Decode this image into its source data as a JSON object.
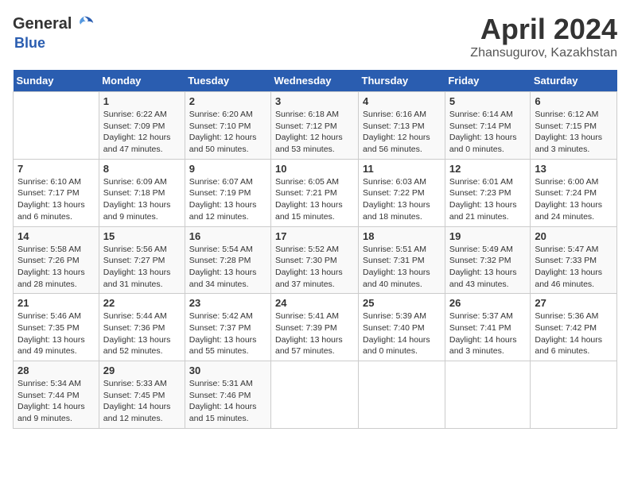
{
  "header": {
    "logo_general": "General",
    "logo_blue": "Blue",
    "title": "April 2024",
    "subtitle": "Zhansugurov, Kazakhstan"
  },
  "calendar": {
    "days_of_week": [
      "Sunday",
      "Monday",
      "Tuesday",
      "Wednesday",
      "Thursday",
      "Friday",
      "Saturday"
    ],
    "weeks": [
      [
        {
          "day": "",
          "info": ""
        },
        {
          "day": "1",
          "info": "Sunrise: 6:22 AM\nSunset: 7:09 PM\nDaylight: 12 hours\nand 47 minutes."
        },
        {
          "day": "2",
          "info": "Sunrise: 6:20 AM\nSunset: 7:10 PM\nDaylight: 12 hours\nand 50 minutes."
        },
        {
          "day": "3",
          "info": "Sunrise: 6:18 AM\nSunset: 7:12 PM\nDaylight: 12 hours\nand 53 minutes."
        },
        {
          "day": "4",
          "info": "Sunrise: 6:16 AM\nSunset: 7:13 PM\nDaylight: 12 hours\nand 56 minutes."
        },
        {
          "day": "5",
          "info": "Sunrise: 6:14 AM\nSunset: 7:14 PM\nDaylight: 13 hours\nand 0 minutes."
        },
        {
          "day": "6",
          "info": "Sunrise: 6:12 AM\nSunset: 7:15 PM\nDaylight: 13 hours\nand 3 minutes."
        }
      ],
      [
        {
          "day": "7",
          "info": "Sunrise: 6:10 AM\nSunset: 7:17 PM\nDaylight: 13 hours\nand 6 minutes."
        },
        {
          "day": "8",
          "info": "Sunrise: 6:09 AM\nSunset: 7:18 PM\nDaylight: 13 hours\nand 9 minutes."
        },
        {
          "day": "9",
          "info": "Sunrise: 6:07 AM\nSunset: 7:19 PM\nDaylight: 13 hours\nand 12 minutes."
        },
        {
          "day": "10",
          "info": "Sunrise: 6:05 AM\nSunset: 7:21 PM\nDaylight: 13 hours\nand 15 minutes."
        },
        {
          "day": "11",
          "info": "Sunrise: 6:03 AM\nSunset: 7:22 PM\nDaylight: 13 hours\nand 18 minutes."
        },
        {
          "day": "12",
          "info": "Sunrise: 6:01 AM\nSunset: 7:23 PM\nDaylight: 13 hours\nand 21 minutes."
        },
        {
          "day": "13",
          "info": "Sunrise: 6:00 AM\nSunset: 7:24 PM\nDaylight: 13 hours\nand 24 minutes."
        }
      ],
      [
        {
          "day": "14",
          "info": "Sunrise: 5:58 AM\nSunset: 7:26 PM\nDaylight: 13 hours\nand 28 minutes."
        },
        {
          "day": "15",
          "info": "Sunrise: 5:56 AM\nSunset: 7:27 PM\nDaylight: 13 hours\nand 31 minutes."
        },
        {
          "day": "16",
          "info": "Sunrise: 5:54 AM\nSunset: 7:28 PM\nDaylight: 13 hours\nand 34 minutes."
        },
        {
          "day": "17",
          "info": "Sunrise: 5:52 AM\nSunset: 7:30 PM\nDaylight: 13 hours\nand 37 minutes."
        },
        {
          "day": "18",
          "info": "Sunrise: 5:51 AM\nSunset: 7:31 PM\nDaylight: 13 hours\nand 40 minutes."
        },
        {
          "day": "19",
          "info": "Sunrise: 5:49 AM\nSunset: 7:32 PM\nDaylight: 13 hours\nand 43 minutes."
        },
        {
          "day": "20",
          "info": "Sunrise: 5:47 AM\nSunset: 7:33 PM\nDaylight: 13 hours\nand 46 minutes."
        }
      ],
      [
        {
          "day": "21",
          "info": "Sunrise: 5:46 AM\nSunset: 7:35 PM\nDaylight: 13 hours\nand 49 minutes."
        },
        {
          "day": "22",
          "info": "Sunrise: 5:44 AM\nSunset: 7:36 PM\nDaylight: 13 hours\nand 52 minutes."
        },
        {
          "day": "23",
          "info": "Sunrise: 5:42 AM\nSunset: 7:37 PM\nDaylight: 13 hours\nand 55 minutes."
        },
        {
          "day": "24",
          "info": "Sunrise: 5:41 AM\nSunset: 7:39 PM\nDaylight: 13 hours\nand 57 minutes."
        },
        {
          "day": "25",
          "info": "Sunrise: 5:39 AM\nSunset: 7:40 PM\nDaylight: 14 hours\nand 0 minutes."
        },
        {
          "day": "26",
          "info": "Sunrise: 5:37 AM\nSunset: 7:41 PM\nDaylight: 14 hours\nand 3 minutes."
        },
        {
          "day": "27",
          "info": "Sunrise: 5:36 AM\nSunset: 7:42 PM\nDaylight: 14 hours\nand 6 minutes."
        }
      ],
      [
        {
          "day": "28",
          "info": "Sunrise: 5:34 AM\nSunset: 7:44 PM\nDaylight: 14 hours\nand 9 minutes."
        },
        {
          "day": "29",
          "info": "Sunrise: 5:33 AM\nSunset: 7:45 PM\nDaylight: 14 hours\nand 12 minutes."
        },
        {
          "day": "30",
          "info": "Sunrise: 5:31 AM\nSunset: 7:46 PM\nDaylight: 14 hours\nand 15 minutes."
        },
        {
          "day": "",
          "info": ""
        },
        {
          "day": "",
          "info": ""
        },
        {
          "day": "",
          "info": ""
        },
        {
          "day": "",
          "info": ""
        }
      ]
    ]
  }
}
